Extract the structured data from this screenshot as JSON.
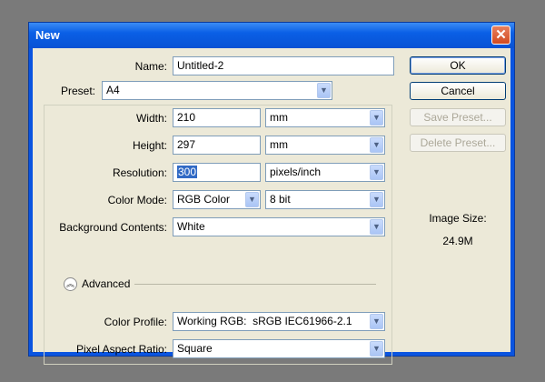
{
  "window": {
    "title": "New",
    "close_icon": "close-icon"
  },
  "name": {
    "label": "Name:",
    "value": "Untitled-2"
  },
  "preset": {
    "label": "Preset:",
    "value": "A4"
  },
  "width": {
    "label": "Width:",
    "value": "210",
    "unit": "mm"
  },
  "height": {
    "label": "Height:",
    "value": "297",
    "unit": "mm"
  },
  "resolution": {
    "label": "Resolution:",
    "value": "300",
    "unit": "pixels/inch"
  },
  "color_mode": {
    "label": "Color Mode:",
    "value": "RGB Color",
    "bit_depth": "8 bit"
  },
  "background": {
    "label": "Background Contents:",
    "value": "White"
  },
  "advanced": {
    "label": "Advanced"
  },
  "color_profile": {
    "label": "Color Profile:",
    "value": "Working RGB:  sRGB IEC61966-2.1"
  },
  "pixel_aspect": {
    "label": "Pixel Aspect Ratio:",
    "value": "Square"
  },
  "buttons": {
    "ok": "OK",
    "cancel": "Cancel",
    "save_preset": "Save Preset...",
    "delete_preset": "Delete Preset..."
  },
  "image_size": {
    "label": "Image Size:",
    "value": "24.9M"
  },
  "colors": {
    "title_bar": "#0a5fe6",
    "dialog_bg": "#ece9d8",
    "selection": "#316ac5"
  }
}
